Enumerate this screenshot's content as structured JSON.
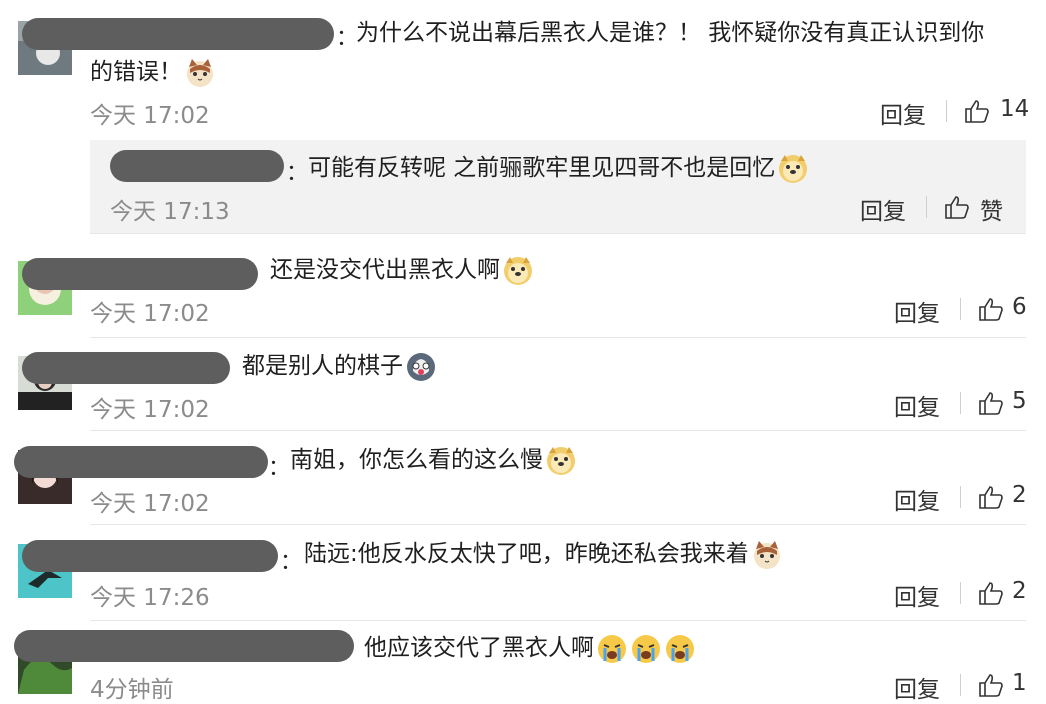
{
  "comments": [
    {
      "text_line1": "为什么不说出幕后黑衣人是谁？！ 我怀疑你没有真正认识到你",
      "text_line2": "的错误！",
      "emoji": "cat-face",
      "time": "今天 17:02",
      "reply_label": "回复",
      "likes": "14",
      "sub_reply": {
        "text": "可能有反转呢 之前骊歌牢里见四哥不也是回忆",
        "emoji": "doge-face",
        "time": "今天 17:13",
        "reply_label": "回复",
        "likes_label": "赞"
      }
    },
    {
      "text": "还是没交代出黑衣人啊",
      "emoji": "doge-face",
      "time": "今天 17:02",
      "reply_label": "回复",
      "likes": "6"
    },
    {
      "text": "都是别人的棋子",
      "emoji": "husky-face",
      "time": "今天 17:02",
      "reply_label": "回复",
      "likes": "5"
    },
    {
      "text": "南姐，你怎么看的这么慢",
      "emoji": "doge-face",
      "time": "今天 17:02",
      "reply_label": "回复",
      "likes": "2"
    },
    {
      "text": "陆远:他反水反太快了吧，昨晚还私会我来着",
      "emoji": "cat-face",
      "time": "今天 17:26",
      "reply_label": "回复",
      "likes": "2"
    },
    {
      "text": "他应该交代了黑衣人啊",
      "emoji": "crying-face",
      "time": "4分钟前",
      "reply_label": "回复",
      "likes": "1"
    }
  ],
  "colors": {
    "redaction": "#5e5e5e",
    "timestamp": "#8b8b8b",
    "reply_bg": "#f2f2f2"
  }
}
